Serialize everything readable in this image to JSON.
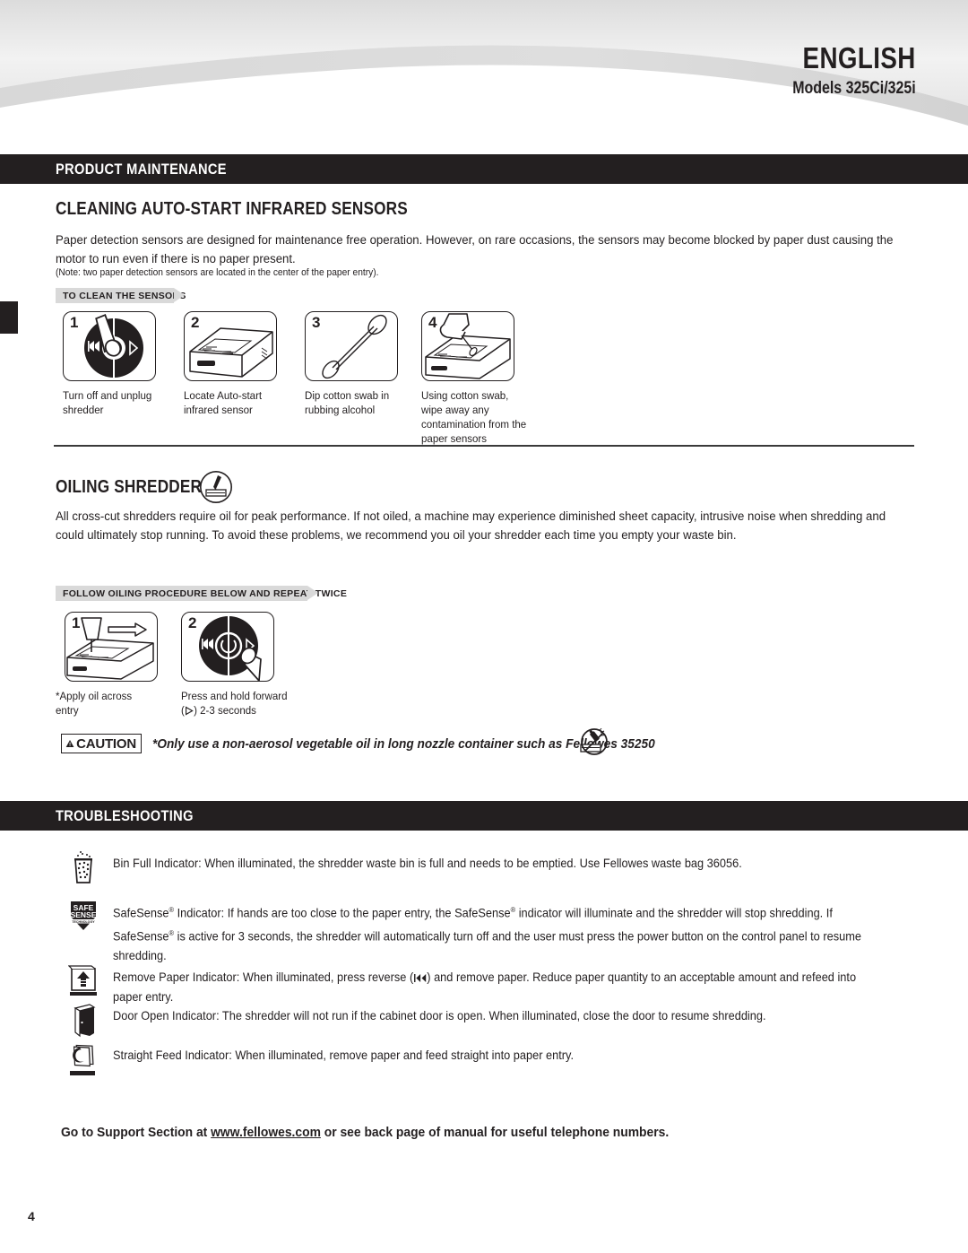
{
  "header": {
    "language_title": "ENGLISH",
    "models": "Models 325Ci/325i"
  },
  "sections": {
    "product_maintenance": {
      "bar_label": "PRODUCT MAINTENANCE",
      "heading": "CLEANING AUTO-START INFRARED SENSORS",
      "body": "Paper detection sensors are designed for maintenance free operation. However, on rare occasions, the sensors may become blocked by paper dust causing the motor to run even if there is no paper present.",
      "note": "(Note: two paper detection sensors are located in the center of the paper entry).",
      "tag_label": "TO CLEAN THE SENSORS",
      "steps": [
        {
          "number": "1",
          "caption": "Turn off and unplug shredder",
          "icon": "control-dial-power-press-icon"
        },
        {
          "number": "2",
          "caption": "Locate Auto-start infrared sensor",
          "icon": "shredder-top-icon"
        },
        {
          "number": "3",
          "caption": "Dip cotton swab in rubbing alcohol",
          "icon": "cotton-swab-icon"
        },
        {
          "number": "4",
          "caption": "Using cotton swab, wipe away any contamination from the paper sensors",
          "icon": "hand-swab-wipe-icon"
        }
      ]
    },
    "oiling_shredder": {
      "heading": "OILING SHREDDER",
      "heading_icon": "oil-bottle-circle-icon",
      "body": "All cross-cut shredders require oil for peak performance. If not oiled, a machine may experience diminished sheet capacity, intrusive noise when shredding and could ultimately stop running. To avoid these problems, we recommend you oil your shredder each time you empty your waste bin.",
      "tag_label": "FOLLOW OILING PROCEDURE BELOW AND REPEAT TWICE",
      "steps": [
        {
          "number": "1",
          "caption": "*Apply oil across entry",
          "icon": "oil-bottle-entry-icon"
        },
        {
          "number": "2",
          "caption_line1": "Press and hold forward",
          "caption_line2_pre": "(",
          "caption_line2_icon": "forward-triangle-icon",
          "caption_line2_post": ") 2-3 seconds",
          "icon": "control-dial-forward-press-icon"
        }
      ],
      "caution": {
        "label": "CAUTION",
        "text": "*Only use a non-aerosol vegetable oil in long nozzle container such as Fellowes 35250",
        "icon": "no-aerosol-spray-icon"
      }
    },
    "troubleshooting": {
      "bar_label": "TROUBLESHOOTING",
      "items": [
        {
          "icon": "bin-full-icon",
          "text": "Bin Full Indicator: When illuminated, the shredder waste bin is full and needs to be emptied.  Use Fellowes waste bag 36056."
        },
        {
          "icon": "safesense-shield-icon",
          "text_part1": "SafeSense",
          "text_part2": " Indicator:  If hands are too close to the paper entry, the SafeSense",
          "text_part3": " indicator will illuminate and the shredder will stop shredding.  If SafeSense",
          "text_part4": " is active for 3 seconds, the shredder will automatically turn off and the user must press the power button on the control panel to resume shredding.",
          "registered_mark": "®"
        },
        {
          "icon": "remove-paper-icon",
          "text_pre": "Remove Paper Indicator:  When illuminated, press reverse (",
          "text_post": ") and remove paper.  Reduce paper quantity to an acceptable amount and refeed into paper entry.",
          "inline_icon": "reverse-icon"
        },
        {
          "icon": "door-open-icon",
          "text": "Door Open Indicator:  The shredder will not run if the cabinet door is open.  When illuminated, close the door to resume shredding."
        },
        {
          "icon": "straight-feed-icon",
          "text": "Straight Feed Indicator:  When illuminated, remove paper and feed straight into paper entry."
        }
      ]
    }
  },
  "footer": {
    "support_pre": "Go to Support Section at ",
    "support_link": "www.fellowes.com",
    "support_post": " or see back page of manual for useful telephone numbers.",
    "page_number": "4"
  },
  "colors": {
    "ink": "#231f20",
    "bar": "#231f20",
    "tag_gray": "#d9d9d9",
    "banner_gray": "#dcdcdc",
    "page_bg": "#ffffff"
  }
}
